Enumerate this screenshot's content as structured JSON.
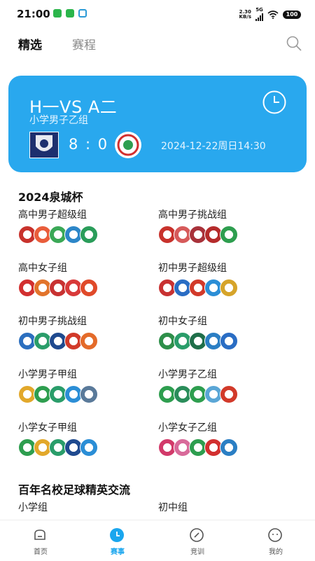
{
  "status": {
    "time": "21:00",
    "net_speed": "2.30",
    "net_unit": "KB/s",
    "net_type": "5G",
    "battery": "100"
  },
  "tabs": {
    "selected": "精选",
    "other": "赛程"
  },
  "match": {
    "title": "H一VS A二",
    "group": "小学男子乙组",
    "score": "8 : 0",
    "time": "2024-12-22周日14:30"
  },
  "section1": {
    "title": "2024泉城杯",
    "groups": [
      {
        "name": "高中男子超级组",
        "logo_colors": [
          "#c8322c",
          "#e95d3b",
          "#3aa856",
          "#2c86c8",
          "#2a9d5a"
        ]
      },
      {
        "name": "高中男子挑战组",
        "logo_colors": [
          "#c8322c",
          "#d65a5a",
          "#a8323a",
          "#b52b2b",
          "#2e9e4f"
        ]
      },
      {
        "name": "高中女子组",
        "logo_colors": [
          "#d23030",
          "#e2742b",
          "#c83232",
          "#d83a3a",
          "#e04a2a"
        ]
      },
      {
        "name": "初中男子超级组",
        "logo_colors": [
          "#c83232",
          "#2a6dc4",
          "#d23a2a",
          "#2b8ed6",
          "#d6a42a"
        ]
      },
      {
        "name": "初中男子挑战组",
        "logo_colors": [
          "#2c6fbf",
          "#2a9d6a",
          "#1f4a8f",
          "#d23a2a",
          "#e46b2a"
        ]
      },
      {
        "name": "初中女子组",
        "logo_colors": [
          "#2e8f4a",
          "#2a9d6a",
          "#1f6f4a",
          "#2b7fc4",
          "#2a6dc4"
        ]
      },
      {
        "name": "小学男子甲组",
        "logo_colors": [
          "#e2a82b",
          "#2e9e4f",
          "#2a9d6a",
          "#2b8ed6",
          "#5a7a9a"
        ]
      },
      {
        "name": "小学男子乙组",
        "logo_colors": [
          "#2e9e4f",
          "#2a8d5a",
          "#2e9e4f",
          "#5aa6d6",
          "#d23a2a"
        ]
      },
      {
        "name": "小学女子甲组",
        "logo_colors": [
          "#2e9e4f",
          "#e2a82b",
          "#2a9d6a",
          "#1f4a8f",
          "#2b8ed6"
        ]
      },
      {
        "name": "小学女子乙组",
        "logo_colors": [
          "#d23a6a",
          "#d86a9a",
          "#2e9e4f",
          "#d23030",
          "#2b7fc4"
        ]
      }
    ]
  },
  "section2": {
    "title": "百年名校足球精英交流",
    "groups": [
      {
        "name": "小学组",
        "logo_colors": [
          "#2e9e4f",
          "#2a9d6a",
          "#e2a82b"
        ]
      },
      {
        "name": "初中组",
        "logo_colors": [
          "#d23030",
          "#e2742b",
          "#2b7fc4"
        ]
      }
    ]
  },
  "nav": {
    "home": "首页",
    "events": "赛事",
    "training": "竞训",
    "mine": "我的"
  },
  "colors": {
    "accent": "#29a8ee",
    "nav_active": "#1aa6ee"
  }
}
